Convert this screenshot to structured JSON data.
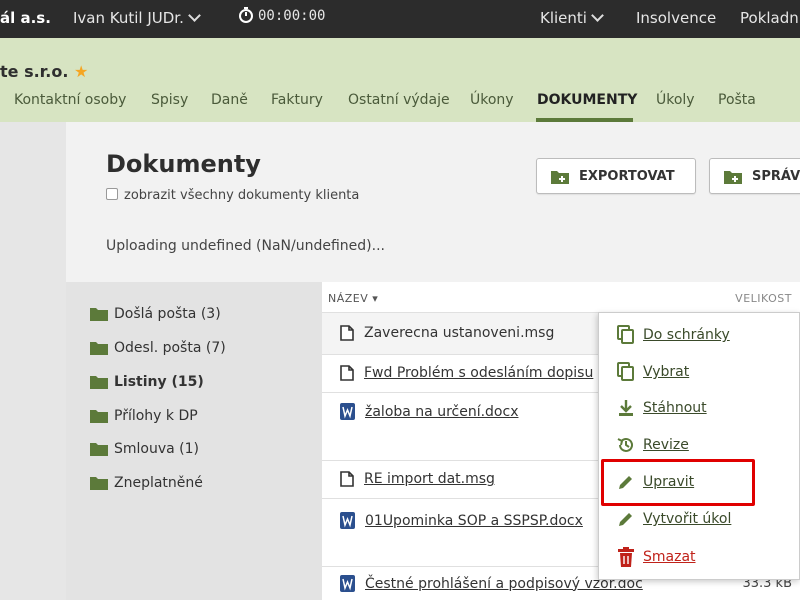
{
  "topbar": {
    "company": "ál a.s.",
    "user": "Ivan Kutil JUDr.",
    "timer": "00:00:00",
    "nav": {
      "klienti": "Klienti",
      "insolvence": "Insolvence",
      "pokladna": "Pokladn"
    }
  },
  "client": {
    "name": "te s.r.o."
  },
  "tabs": [
    "Kontaktní osoby",
    "Spisy",
    "Daně",
    "Faktury",
    "Ostatní výdaje",
    "Úkony",
    "DOKUMENTY",
    "Úkoly",
    "Pošta"
  ],
  "active_tab": "DOKUMENTY",
  "content": {
    "title": "Dokumenty",
    "checkbox_label": "zobrazit všechny dokumenty klienta",
    "uploading": "Uploading undefined (NaN/undefined)...",
    "btn_export": "EXPORTOVAT",
    "btn_sprav": "SPRÁV"
  },
  "folders": [
    {
      "label": "Došlá pošta (3)"
    },
    {
      "label": "Odesl. pošta (7)"
    },
    {
      "label": "Listiny (15)"
    },
    {
      "label": "Přílohy k DP"
    },
    {
      "label": "Smlouva (1)"
    },
    {
      "label": "Zneplatněné"
    }
  ],
  "columns": {
    "name": "NÁZEV",
    "size": "VELIKOST"
  },
  "files": [
    {
      "name": "Zaverecna ustanoveni.msg",
      "icon": "file-icon"
    },
    {
      "name": "Fwd Problém s odesláním dopisu",
      "icon": "file-icon"
    },
    {
      "name": "žaloba na určení.docx",
      "icon": "word-icon"
    },
    {
      "name": "RE import dat.msg",
      "icon": "file-icon"
    },
    {
      "name": "01Upominka SOP a SSPSP.docx",
      "icon": "word-icon"
    },
    {
      "name": "Čestné prohlášení a podpisový vzor.doc",
      "icon": "word-icon",
      "size": "33.3 kB"
    }
  ],
  "menu": [
    {
      "label": "Do schránky",
      "icon": "copy-icon"
    },
    {
      "label": "Vybrat",
      "icon": "copy-icon"
    },
    {
      "label": "Stáhnout",
      "icon": "download-icon"
    },
    {
      "label": "Revize",
      "icon": "history-icon"
    },
    {
      "label": "Upravit",
      "icon": "pencil-icon"
    },
    {
      "label": "Vytvořit úkol",
      "icon": "pencil-icon"
    },
    {
      "label": "Smazat",
      "icon": "trash-icon"
    }
  ],
  "colors": {
    "topbar": "#2c2c2c",
    "header_green": "#d7e4c2",
    "accent_green": "#5c7a3a",
    "danger": "#c0221a",
    "highlight": "#e00000"
  }
}
